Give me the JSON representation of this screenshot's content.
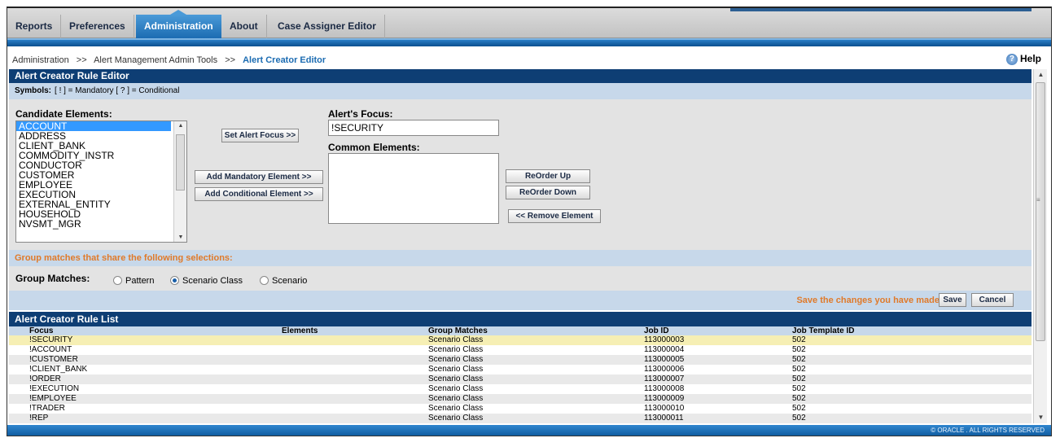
{
  "nav": {
    "tabs": [
      {
        "label": "Reports"
      },
      {
        "label": "Preferences"
      },
      {
        "label": "Administration"
      },
      {
        "label": "About"
      },
      {
        "label": "Case Assigner Editor"
      }
    ],
    "active_tab": "Administration"
  },
  "breadcrumb": {
    "items": [
      "Administration",
      "Alert Management Admin Tools",
      "Alert Creator Editor"
    ],
    "separator": ">>"
  },
  "help_label": "Help",
  "editor": {
    "title": "Alert Creator Rule Editor",
    "symbols_label": "Symbols:",
    "symbols_text": "[ ! ] = Mandatory  [ ? ] = Conditional",
    "candidate_label": "Candidate Elements:",
    "candidate_items": [
      "ACCOUNT",
      "ADDRESS",
      "CLIENT_BANK",
      "COMMODITY_INSTR",
      "CONDUCTOR",
      "CUSTOMER",
      "EMPLOYEE",
      "EXECUTION",
      "EXTERNAL_ENTITY",
      "HOUSEHOLD",
      "NVSMT_MGR"
    ],
    "selected_candidate": "ACCOUNT",
    "set_focus_button": "Set Alert Focus >>",
    "add_mandatory_button": "Add Mandatory Element >>",
    "add_conditional_button": "Add Conditional Element >>",
    "focus_label": "Alert's Focus:",
    "focus_value": "!SECURITY",
    "common_label": "Common Elements:",
    "reorder_up_button": "ReOrder Up",
    "reorder_down_button": "ReOrder Down",
    "remove_button": "<< Remove Element",
    "group_title": "Group matches that share the following selections:",
    "group_label": "Group Matches:",
    "group_options": [
      "Pattern",
      "Scenario Class",
      "Scenario"
    ],
    "group_selected": "Scenario Class",
    "save_message": "Save the changes you have made.",
    "save_button": "Save",
    "cancel_button": "Cancel"
  },
  "rule_list": {
    "title": "Alert Creator Rule List",
    "columns": [
      "Focus",
      "Elements",
      "Group Matches",
      "Job ID",
      "Job Template ID"
    ],
    "rows": [
      [
        "!SECURITY",
        "",
        "Scenario Class",
        "113000003",
        "502"
      ],
      [
        "!ACCOUNT",
        "",
        "Scenario Class",
        "113000004",
        "502"
      ],
      [
        "!CUSTOMER",
        "",
        "Scenario Class",
        "113000005",
        "502"
      ],
      [
        "!CLIENT_BANK",
        "",
        "Scenario Class",
        "113000006",
        "502"
      ],
      [
        "!ORDER",
        "",
        "Scenario Class",
        "113000007",
        "502"
      ],
      [
        "!EXECUTION",
        "",
        "Scenario Class",
        "113000008",
        "502"
      ],
      [
        "!EMPLOYEE",
        "",
        "Scenario Class",
        "113000009",
        "502"
      ],
      [
        "!TRADER",
        "",
        "Scenario Class",
        "113000010",
        "502"
      ],
      [
        "!REP",
        "",
        "Scenario Class",
        "113000011",
        "502"
      ]
    ],
    "selected_row": 0
  },
  "footer_text": "© ORACLE . ALL RIGHTS RESERVED",
  "colors": {
    "header_navy": "#0e3e74",
    "accent_blue": "#1c6cb2",
    "orange_text": "#e07a2a",
    "section_light": "#c7d8ea"
  }
}
